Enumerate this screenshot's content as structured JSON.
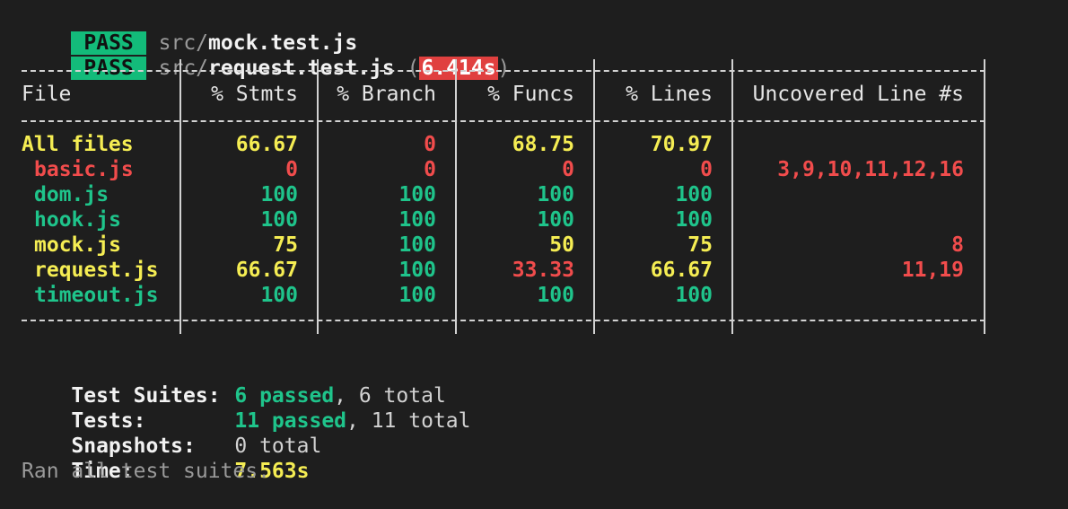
{
  "pass_lines": [
    {
      "badge": "PASS",
      "prefix": "src/",
      "file": "mock.test.js",
      "timing": ""
    },
    {
      "badge": "PASS",
      "prefix": "src/",
      "file": "request.test.js",
      "timing": "6.414s"
    }
  ],
  "table": {
    "headers": [
      "File",
      "% Stmts",
      "% Branch",
      "% Funcs",
      "% Lines",
      "Uncovered Line #s"
    ],
    "rows": [
      {
        "file": "All files",
        "stmts": "66.67",
        "branch": "0",
        "funcs": "68.75",
        "lines": "70.97",
        "uncovered": ""
      },
      {
        "file": "basic.js",
        "stmts": "0",
        "branch": "0",
        "funcs": "0",
        "lines": "0",
        "uncovered": "3,9,10,11,12,16"
      },
      {
        "file": "dom.js",
        "stmts": "100",
        "branch": "100",
        "funcs": "100",
        "lines": "100",
        "uncovered": ""
      },
      {
        "file": "hook.js",
        "stmts": "100",
        "branch": "100",
        "funcs": "100",
        "lines": "100",
        "uncovered": ""
      },
      {
        "file": "mock.js",
        "stmts": "75",
        "branch": "100",
        "funcs": "50",
        "lines": "75",
        "uncovered": "8"
      },
      {
        "file": "request.js",
        "stmts": "66.67",
        "branch": "100",
        "funcs": "33.33",
        "lines": "66.67",
        "uncovered": "11,19"
      },
      {
        "file": "timeout.js",
        "stmts": "100",
        "branch": "100",
        "funcs": "100",
        "lines": "100",
        "uncovered": ""
      }
    ]
  },
  "summary": {
    "suites_label": "Test Suites:",
    "suites_passed": "6 passed",
    "suites_total": ", 6 total",
    "tests_label": "Tests:",
    "tests_passed": "11 passed",
    "tests_total": ", 11 total",
    "snapshots_label": "Snapshots:",
    "snapshots_value": "0 total",
    "time_label": "Time:",
    "time_value": "7.563s",
    "ran_all": "Ran all test suites."
  },
  "colors": {
    "background": "#1e1e1e",
    "pass": "#13bb7a",
    "yellow": "#f5ed53",
    "red": "#f14c4c",
    "green": "#1fc48b"
  }
}
